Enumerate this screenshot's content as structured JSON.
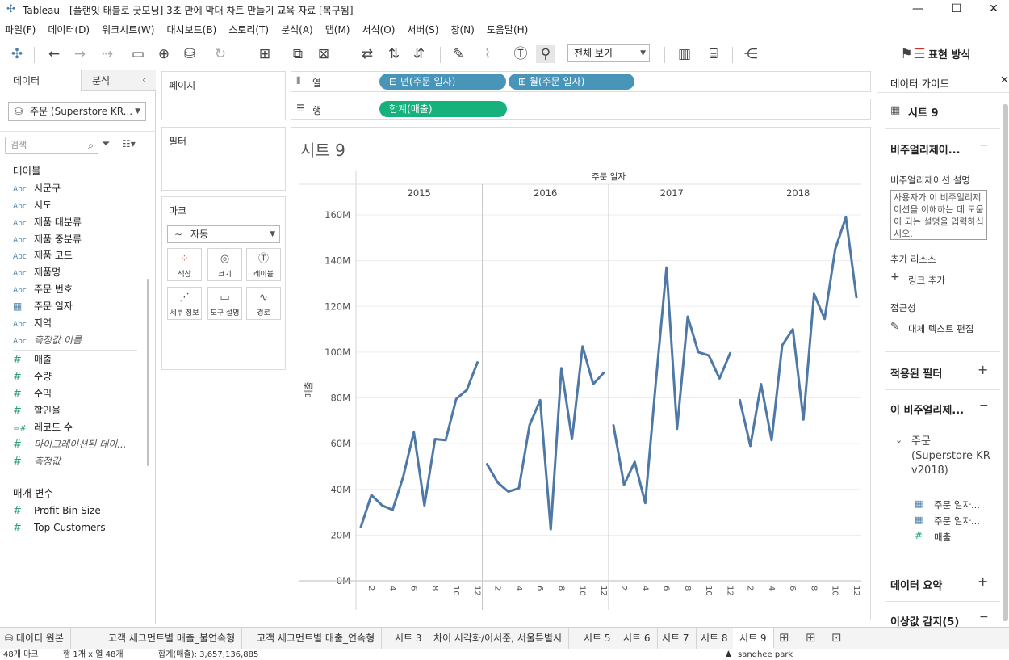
{
  "window": {
    "title": "Tableau - [플랜잇 태블로 굿모닝] 3초 만에 막대 차트 만들기 교육 자료 [복구됨]",
    "minimize": "—",
    "maximize": "☐",
    "close": "✕"
  },
  "menu": [
    "파일(F)",
    "데이터(D)",
    "워크시트(W)",
    "대시보드(B)",
    "스토리(T)",
    "분석(A)",
    "맵(M)",
    "서식(O)",
    "서버(S)",
    "창(N)",
    "도움말(H)"
  ],
  "toolbar": {
    "view_select": "전체 보기",
    "show_me": "표현 방식"
  },
  "left_pane": {
    "tab_data": "데이터",
    "tab_analysis": "분석",
    "datasource": "주문 (Superstore KR...",
    "search_placeholder": "검색",
    "tables_header": "테이블",
    "dimensions": [
      {
        "icon": "Abc",
        "name": "시군구"
      },
      {
        "icon": "Abc",
        "name": "시도"
      },
      {
        "icon": "Abc",
        "name": "제품 대분류"
      },
      {
        "icon": "Abc",
        "name": "제품 중분류"
      },
      {
        "icon": "Abc",
        "name": "제품 코드"
      },
      {
        "icon": "Abc",
        "name": "제품명"
      },
      {
        "icon": "Abc",
        "name": "주문 번호"
      },
      {
        "icon": "date",
        "name": "주문 일자"
      },
      {
        "icon": "Abc",
        "name": "지역"
      },
      {
        "icon": "Abc",
        "name": "측정값 이름"
      }
    ],
    "measures": [
      {
        "icon": "#",
        "name": "매출"
      },
      {
        "icon": "#",
        "name": "수량"
      },
      {
        "icon": "#",
        "name": "수익"
      },
      {
        "icon": "#",
        "name": "할인율"
      },
      {
        "icon": "=#",
        "name": "레코드 수"
      },
      {
        "icon": "#",
        "name": "마이그레이션된 데이..."
      },
      {
        "icon": "#",
        "name": "측정값"
      }
    ],
    "params_header": "매개 변수",
    "params": [
      {
        "icon": "#",
        "name": "Profit Bin Size"
      },
      {
        "icon": "#",
        "name": "Top Customers"
      }
    ]
  },
  "cards": {
    "pages": "페이지",
    "filters": "필터",
    "marks": "마크",
    "mark_type": "자동",
    "mark_buttons": [
      {
        "icon": "color-icon",
        "label": "색상",
        "glyph": "⁘"
      },
      {
        "icon": "size-icon",
        "label": "크기",
        "glyph": "◎"
      },
      {
        "icon": "label-icon",
        "label": "레이블",
        "glyph": "T"
      },
      {
        "icon": "detail-icon",
        "label": "세부 정보",
        "glyph": "⋰"
      },
      {
        "icon": "tooltip-icon",
        "label": "도구 설명",
        "glyph": "▭"
      },
      {
        "icon": "path-icon",
        "label": "경로",
        "glyph": "∿"
      }
    ]
  },
  "shelves": {
    "columns_label": "열",
    "rows_label": "행",
    "columns_pills": [
      "년(주문 일자)",
      "월(주문 일자)"
    ],
    "rows_pills": [
      "합계(매출)"
    ]
  },
  "sheet": {
    "title": "시트 9"
  },
  "chart_data": {
    "type": "line",
    "title": "",
    "header": "주문 일자",
    "ylabel": "매출",
    "xlabel": "",
    "ylim": [
      0,
      160000000
    ],
    "y_ticks": [
      "0M",
      "20M",
      "40M",
      "60M",
      "80M",
      "100M",
      "120M",
      "140M",
      "160M"
    ],
    "x_ticks": [
      "2",
      "4",
      "6",
      "8",
      "10",
      "12"
    ],
    "grid": true,
    "color": "#4e79a7",
    "panes": [
      {
        "year": "2015",
        "months": [
          1,
          2,
          3,
          4,
          5,
          6,
          7,
          8,
          9,
          10,
          11,
          12
        ],
        "values": [
          23500000,
          37500000,
          33000000,
          31000000,
          45500000,
          65000000,
          33000000,
          62000000,
          61500000,
          79500000,
          83500000,
          95500000
        ]
      },
      {
        "year": "2016",
        "months": [
          1,
          2,
          3,
          4,
          5,
          6,
          7,
          8,
          9,
          10,
          11,
          12
        ],
        "values": [
          51000000,
          43000000,
          39000000,
          40500000,
          68000000,
          79000000,
          22500000,
          93000000,
          62000000,
          102500000,
          86000000,
          91000000
        ]
      },
      {
        "year": "2017",
        "months": [
          1,
          2,
          3,
          4,
          5,
          6,
          7,
          8,
          9,
          10,
          11,
          12
        ],
        "values": [
          68000000,
          42000000,
          52000000,
          34000000,
          87000000,
          137000000,
          66500000,
          115500000,
          100000000,
          98500000,
          88500000,
          99500000
        ]
      },
      {
        "year": "2018",
        "months": [
          1,
          2,
          3,
          4,
          5,
          6,
          7,
          8,
          9,
          10,
          11,
          12
        ],
        "values": [
          79000000,
          59000000,
          86000000,
          61500000,
          103000000,
          110000000,
          70500000,
          125500000,
          114500000,
          145000000,
          159000000,
          124000000
        ]
      }
    ]
  },
  "right_pane": {
    "header": "데이터 가이드",
    "sheet_name": "시트 9",
    "viz_section": "비주얼리제이...",
    "viz_desc_label": "비주얼리제이션 설명",
    "viz_desc_placeholder": "사용자가 이 비주얼리제이션을 이해하는 데 도움이 되는 설명을 입력하십시오.",
    "resources_label": "추가 리소스",
    "add_link": "링크 추가",
    "accessibility_label": "접근성",
    "alt_text": "대체 텍스트 편집",
    "applied_filters": "적용된 필터",
    "this_viz": "이 비주얼리제...",
    "datasource_name": "주문 (Superstore KR v2018)",
    "fields": [
      "주문 일자...",
      "주문 일자...",
      "매출"
    ],
    "data_summary": "데이터 요약",
    "outliers": "이상값 감지(5)"
  },
  "bottom_tabs": [
    {
      "label": "데이터 원본",
      "active": false
    },
    {
      "label": "고객 세그먼트별 매출_불연속형",
      "active": false
    },
    {
      "label": "고객 세그먼트별 매출_연속형",
      "active": false
    },
    {
      "label": "시트 3",
      "active": false
    },
    {
      "label": "차이 시각화/이서준, 서울특별시",
      "active": false
    },
    {
      "label": "시트 5",
      "active": false
    },
    {
      "label": "시트 6",
      "active": false
    },
    {
      "label": "시트 7",
      "active": false
    },
    {
      "label": "시트 8",
      "active": false
    },
    {
      "label": "시트 9",
      "active": true
    }
  ],
  "status": {
    "marks": "48개 마크",
    "rows_cols": "행 1개 x 열 48개",
    "sum": "합계(매출): 3,657,136,885",
    "user": "sanghee park"
  }
}
